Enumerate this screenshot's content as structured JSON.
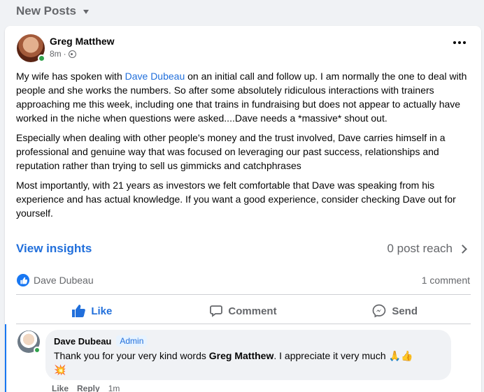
{
  "feed": {
    "title": "New Posts"
  },
  "post": {
    "author": "Greg Matthew",
    "time": "8m",
    "more_label": "•••",
    "paragraphs": {
      "p1_before": "My wife has spoken with ",
      "p1_mention": "Dave Dubeau",
      "p1_after": " on an initial call and follow up.  I am normally the one to deal with people and she works the numbers.  So after some absolutely ridiculous interactions with trainers approaching me this week, including one that trains in fundraising but does not appear to actually have worked in the niche when questions were asked....Dave needs a *massive* shout out.",
      "p2": "Especially when dealing with other people's money and the trust involved, Dave carries himself in a professional and genuine way that was focused on leveraging our past success, relationships and reputation rather than trying to sell us gimmicks and catchphrases",
      "p3": "Most importantly, with 21 years as investors we felt comfortable that Dave was speaking from his experience and has actual knowledge. If you want a good experience, consider checking Dave out for yourself."
    },
    "insights_label": "View insights",
    "reach_label": "0 post reach",
    "reactor": "Dave Dubeau",
    "comment_count": "1 comment",
    "actions": {
      "like": "Like",
      "comment": "Comment",
      "send": "Send"
    }
  },
  "comment": {
    "author": "Dave Dubeau",
    "badge": "Admin",
    "text_before": "Thank you for your very kind words ",
    "text_bold": "Greg Matthew",
    "text_after": ". I appreciate it very much 🙏👍",
    "text_line2": "💥",
    "like": "Like",
    "reply": "Reply",
    "time": "1m"
  },
  "colors": {
    "accent": "#216fdb",
    "online": "#31a24c",
    "muted": "#65676b"
  }
}
